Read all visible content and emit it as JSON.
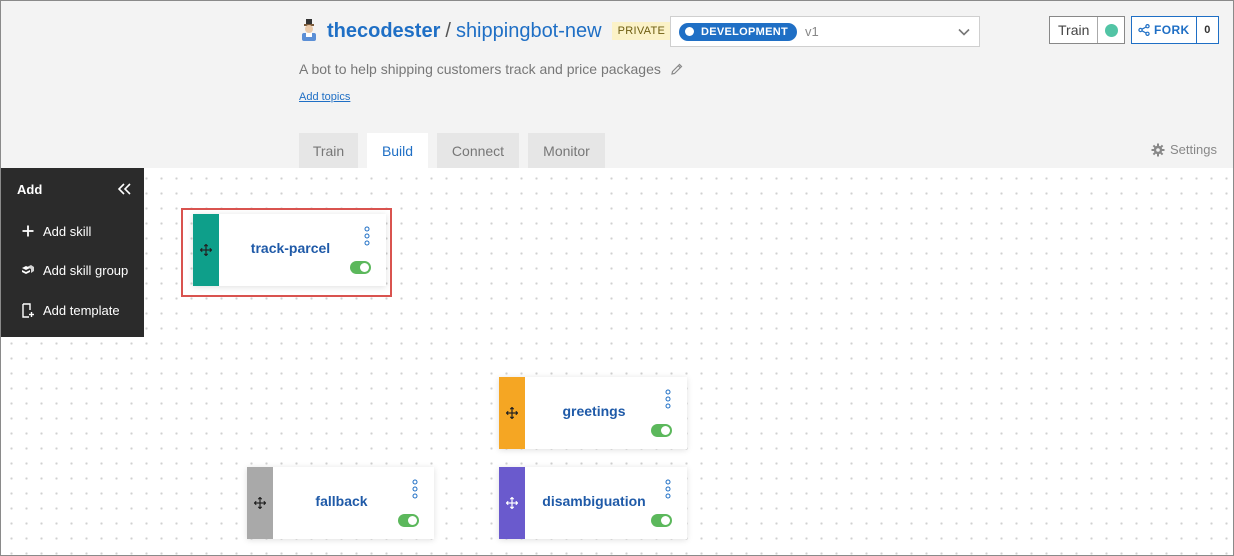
{
  "header": {
    "owner": "thecodester",
    "separator": "/",
    "repo": "shippingbot-new",
    "visibility": "PRIVATE",
    "environment": {
      "label": "DEVELOPMENT",
      "version": "v1"
    },
    "train_button": {
      "label": "Train",
      "status_color": "#52c4a5"
    },
    "fork_button": {
      "label": "FORK",
      "count": "0"
    },
    "description": "A bot to help shipping customers track and price packages",
    "add_topics": "Add topics"
  },
  "tabs": [
    {
      "label": "Train",
      "active": false
    },
    {
      "label": "Build",
      "active": true
    },
    {
      "label": "Connect",
      "active": false
    },
    {
      "label": "Monitor",
      "active": false
    }
  ],
  "settings": {
    "label": "Settings"
  },
  "add_panel": {
    "title": "Add",
    "items": [
      {
        "label": "Add skill",
        "icon": "plus-icon"
      },
      {
        "label": "Add skill group",
        "icon": "skill-group-icon"
      },
      {
        "label": "Add template",
        "icon": "template-icon"
      }
    ]
  },
  "skills": [
    {
      "name": "track-parcel",
      "color": "#0e9f8a",
      "enabled": true,
      "selected": true
    },
    {
      "name": "greetings",
      "color": "#f5a623",
      "enabled": true,
      "selected": false
    },
    {
      "name": "fallback",
      "color": "#a9a9a9",
      "enabled": true,
      "selected": false
    },
    {
      "name": "disambiguation",
      "color": "#6a5acd",
      "enabled": true,
      "selected": false
    }
  ],
  "colors": {
    "accent": "#1f6fc5",
    "highlight": "#d9534f",
    "toggle_on": "#5cb85c"
  }
}
